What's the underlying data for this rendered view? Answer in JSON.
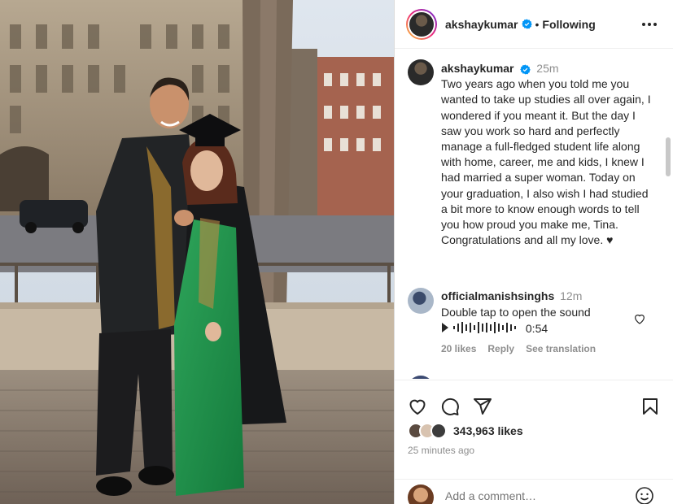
{
  "post": {
    "author": "akshaykumar",
    "follow_status": "Following",
    "separator": "•"
  },
  "caption": {
    "author": "akshaykumar",
    "time": "25m",
    "text": "Two years ago when you told me you wanted to take up studies all over again, I wondered if you meant it. But the day I saw you work so hard and perfectly manage a full-fledged student life along with home, career, me and kids, I knew I had married a super woman. Today on your graduation, I also wish I had studied a bit more to know enough words to tell you how proud you make me, Tina. Congratulations and all my love. ♥"
  },
  "comment": {
    "author": "officialmanishsinghs",
    "time": "12m",
    "text": "Double tap to open the sound",
    "audio_duration": "0:54",
    "likes": "20 likes",
    "reply_label": "Reply",
    "translate_label": "See translation"
  },
  "footer": {
    "likes": "343,963 likes",
    "time_ago": "25 minutes ago",
    "comment_placeholder": "Add a comment…"
  },
  "colors": {
    "verified": "#0095f6",
    "text": "#262626",
    "muted": "#8e8e8e"
  },
  "icons": {
    "header": [
      "verified-badge-icon",
      "more-options-icon"
    ],
    "actions": [
      "heart-icon",
      "comment-icon",
      "share-icon",
      "bookmark-icon"
    ],
    "composer": [
      "emoji-icon"
    ]
  }
}
